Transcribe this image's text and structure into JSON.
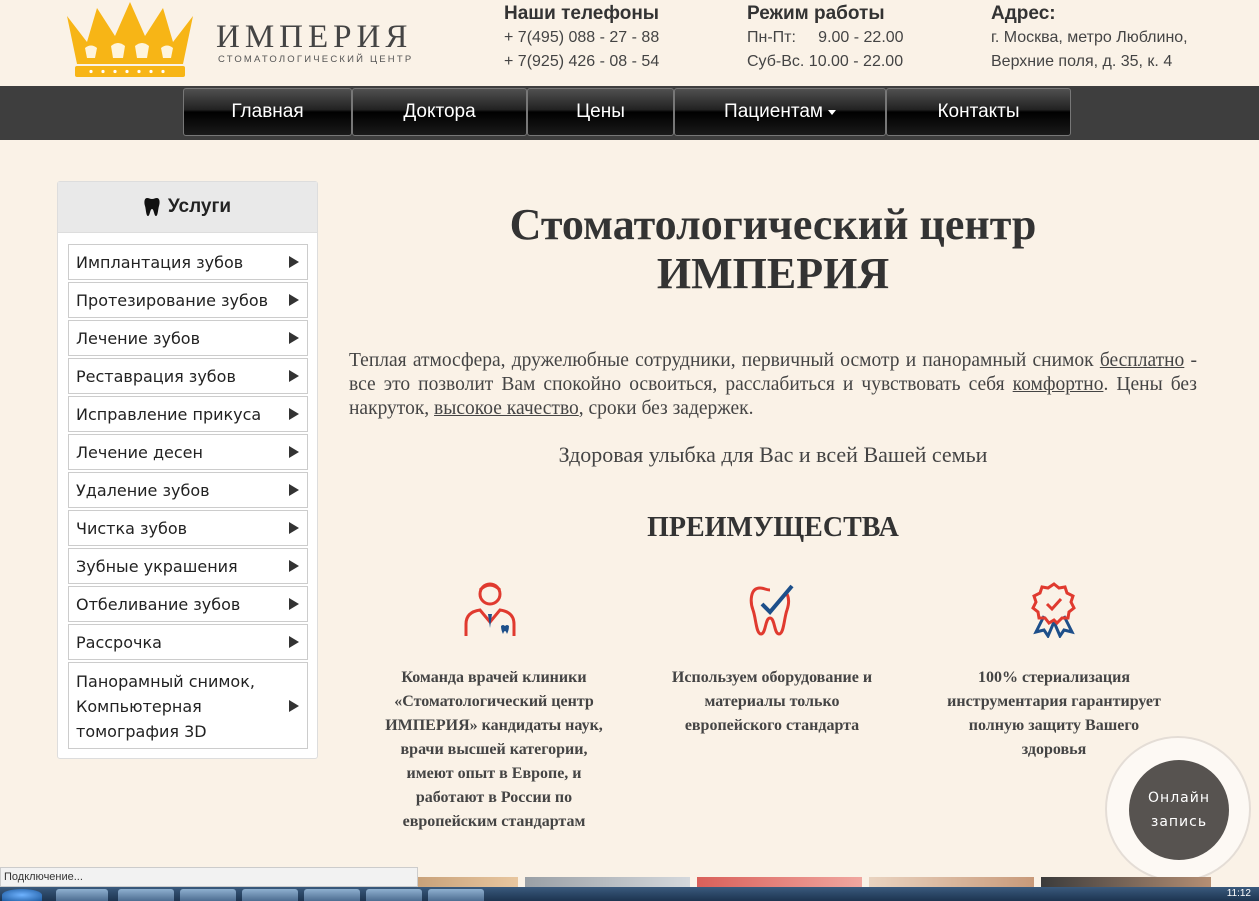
{
  "brand": {
    "name": "ИМПЕРИЯ",
    "subtitle": "СТОМАТОЛОГИЧЕСКИЙ ЦЕНТР",
    "colors": {
      "gold": "#f7b516",
      "nav": "#3e3e3e",
      "accent_red": "#e03a2f",
      "accent_blue": "#1d4f8a"
    }
  },
  "header": {
    "phones": {
      "heading": "Наши телефоны",
      "line1": "+ 7(495) 088 - 27 - 88",
      "line2": "+ 7(925) 426 - 08 - 54"
    },
    "hours": {
      "heading": "Режим работы",
      "line1": "Пн-Пт:     9.00 - 22.00",
      "line2": "Суб-Вс. 10.00 - 22.00"
    },
    "address": {
      "heading": "Адрес:",
      "line1": "г. Москва, метро Люблино,",
      "line2": "Верхние поля, д. 35, к. 4"
    }
  },
  "nav": {
    "items": [
      {
        "label": "Главная"
      },
      {
        "label": "Доктора"
      },
      {
        "label": "Цены"
      },
      {
        "label": "Пациентам",
        "dropdown": true
      },
      {
        "label": "Контакты"
      }
    ]
  },
  "sidebar": {
    "title": "Услуги",
    "items": [
      {
        "label": "Имплантация зубов"
      },
      {
        "label": "Протезирование зубов"
      },
      {
        "label": "Лечение зубов"
      },
      {
        "label": "Реставрация зубов"
      },
      {
        "label": "Исправление прикуса"
      },
      {
        "label": "Лечение десен"
      },
      {
        "label": "Удаление зубов"
      },
      {
        "label": "Чистка зубов"
      },
      {
        "label": "Зубные украшения"
      },
      {
        "label": "Отбеливание зубов"
      },
      {
        "label": "Рассрочка"
      },
      {
        "label_lines": [
          "Панорамный снимок,",
          "Компьютерная",
          "томография 3D"
        ]
      }
    ]
  },
  "main": {
    "title_line1": "Стоматологический центр",
    "title_line2": "ИМПЕРИЯ",
    "intro": {
      "t1": "Теплая атмосфера, дружелюбные сотрудники, первичный осмотр и панорамный снимок ",
      "link1": "бесплатно",
      "t2": " - все это позволит Вам спокойно освоиться, расслабиться и чувствовать себя ",
      "link2": "комфортно",
      "t3": ". Цены без накруток, ",
      "link3": "высокое качество",
      "t4": ", сроки без задержек."
    },
    "tagline": "Здоровая улыбка для Вас и всей Вашей семьи",
    "advantages_title": "ПРЕИМУЩЕСТВА",
    "features": [
      {
        "icon": "doctor-icon",
        "lines": [
          "Команда врачей клиники",
          "«Стоматологический центр",
          "ИМПЕРИЯ» кандидаты наук,",
          "врачи высшей категории,",
          "имеют опыт в Европе, и",
          "работают в России по",
          "европейским стандартам"
        ]
      },
      {
        "icon": "tooth-check-icon",
        "lines": [
          "Используем оборудование и",
          "материалы только",
          "европейского стандарта"
        ]
      },
      {
        "icon": "award-badge-icon",
        "lines": [
          "100% стериализация",
          "инструментария гарантирует",
          "полную защиту Вашего",
          "здоровья"
        ]
      }
    ]
  },
  "online": {
    "line1": "Онлайн",
    "line2": "запись"
  },
  "browser": {
    "status": "Подключение...",
    "clock": "11:12"
  }
}
